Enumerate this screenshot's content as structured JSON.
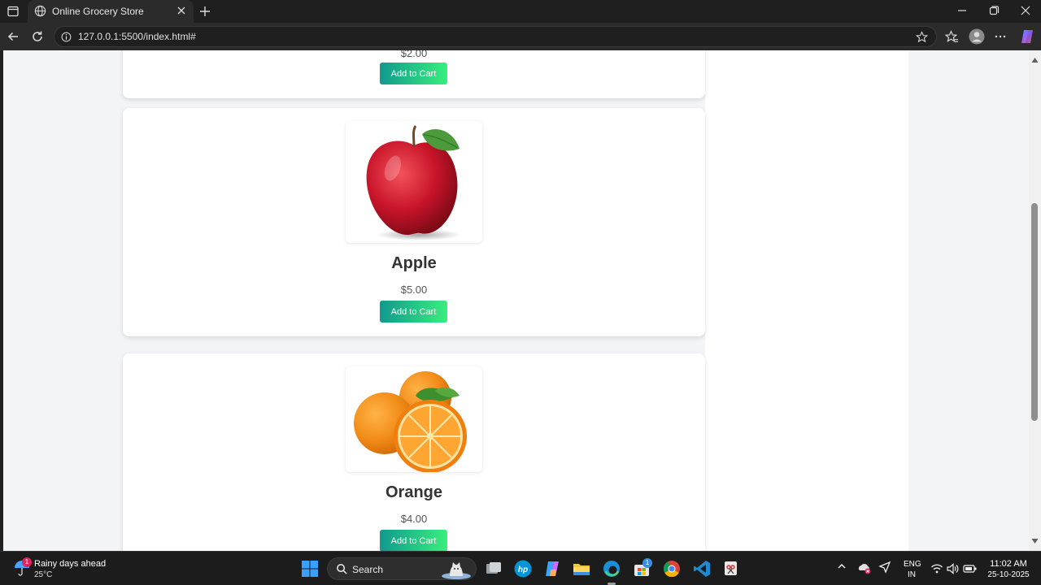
{
  "browser": {
    "tab_title": "Online Grocery Store",
    "url": "127.0.0.1:5500/index.html#"
  },
  "page": {
    "prev_product": {
      "price": "$2.00",
      "button_label": "Add to Cart"
    },
    "products": [
      {
        "name": "Apple",
        "price": "$5.00",
        "button_label": "Add to Cart"
      },
      {
        "name": "Orange",
        "price": "$4.00",
        "button_label": "Add to Cart"
      }
    ]
  },
  "taskbar": {
    "weather_title": "Rainy days ahead",
    "weather_temp": "25°C",
    "weather_badge": "1",
    "search_label": "Search",
    "store_badge": "1",
    "lang_line1": "ENG",
    "lang_line2": "IN",
    "time": "11:02 AM",
    "date": "25-10-2025"
  },
  "colors": {
    "button_gradient_start": "#11998e",
    "button_gradient_end": "#38ef7d",
    "page_background": "#f3f4f6"
  }
}
